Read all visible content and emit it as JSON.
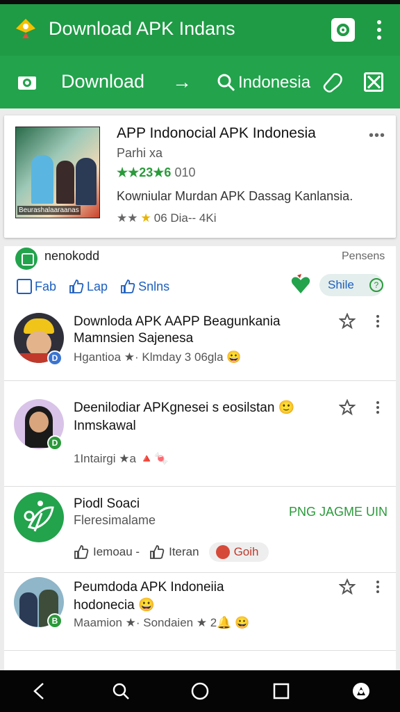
{
  "appbar": {
    "title": "Download APK Indans"
  },
  "toolbar": {
    "download_label": "Download",
    "arrow": "→",
    "search_text": "Indonesia"
  },
  "hero": {
    "title": "APP Indonocial APK Indonesia",
    "developer": "Parhi xa",
    "rating_text": "★★23★6",
    "rating_extra": "010",
    "description": "Kowniular Murdan APK Dassag Kanlansia.",
    "meta_stars": "★★",
    "meta_star_y": "★",
    "meta_text": "06 Dia-- 4Ki",
    "thumb_caption": "Beurashalaaraanas",
    "more": "•••"
  },
  "feed": {
    "header_title": "nenokodd",
    "header_right": "Pensens",
    "chips": [
      {
        "label": "Fab"
      },
      {
        "label": "Lap"
      },
      {
        "label": "Snlns"
      }
    ],
    "share_label": "Shile",
    "share_q": "?",
    "items": [
      {
        "title_line1": "Downloda APK AAPP Beagunkania",
        "title_line2": "Mamnsien Sajenesa",
        "subtitle": "Hgantioa ★· Klmday 3 06gla 😀",
        "badge": "D"
      },
      {
        "title_line1": "Deenilodiar APKgnesei s eosilstan 🙂",
        "title_line2": "Inmskawal",
        "subtitle": "1Intairgi ★a 🔺🍬",
        "badge": "D"
      },
      {
        "title_line1": "Piodl Soaci",
        "title_line2": "Fleresimalame",
        "status": "PNG JAGME UIN",
        "action1": "Iemoau -",
        "action2": "Iteran",
        "pill": "Goih"
      },
      {
        "title_line1": "Peumdoda APK Indoneiia",
        "title_line2": "hodonecia 😀",
        "subtitle": "Maamion ★· Sondaien ★ 2🔔 😀",
        "badge": "B"
      }
    ]
  },
  "colors": {
    "brand_green": "#1f9a45",
    "toolbar_green": "#22a34c",
    "link_blue": "#1d5fbf",
    "rating_green": "#2a9a3a"
  }
}
